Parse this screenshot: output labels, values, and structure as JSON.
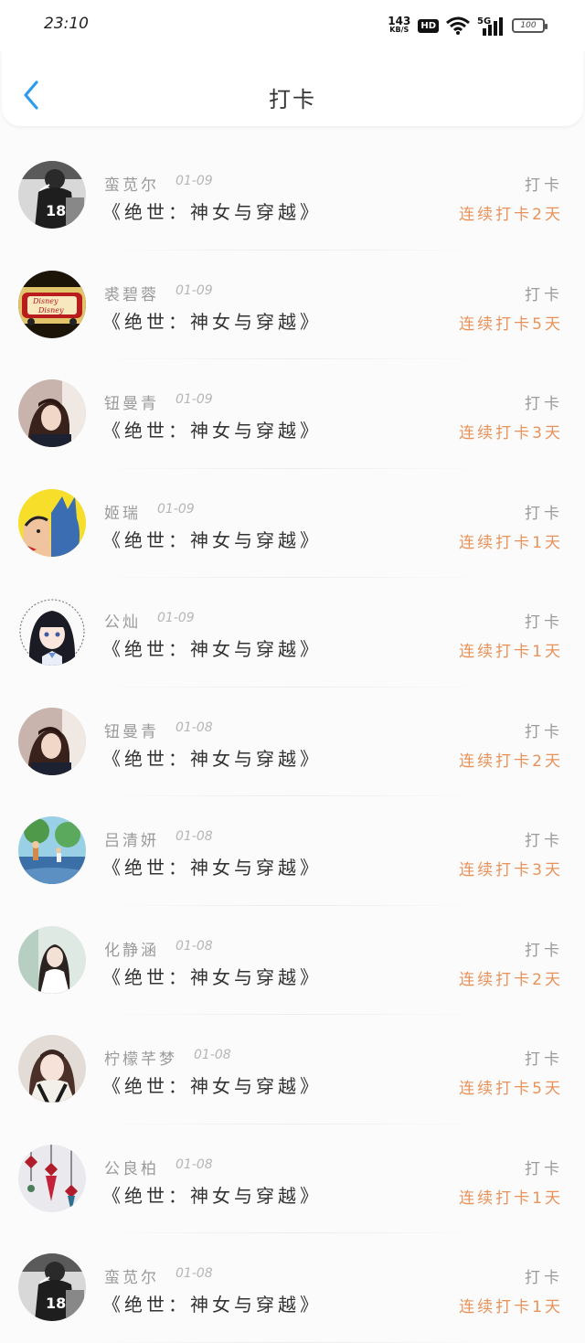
{
  "status_bar": {
    "time": "23:10",
    "net_speed": "143",
    "net_unit": "KB/S",
    "hd": "HD",
    "signal": "5G",
    "battery": "100"
  },
  "header": {
    "title": "打卡"
  },
  "records": [
    {
      "name": "蛮苋尔",
      "date": "01-09",
      "book": "《绝世：神女与穿越》",
      "tag": "打卡",
      "streak": "连续打卡2天",
      "avatar": "bw-boy"
    },
    {
      "name": "裘碧蓉",
      "date": "01-09",
      "book": "《绝世：神女与穿越》",
      "tag": "打卡",
      "streak": "连续打卡5天",
      "avatar": "disney"
    },
    {
      "name": "钮曼青",
      "date": "01-09",
      "book": "《绝世：神女与穿越》",
      "tag": "打卡",
      "streak": "连续打卡3天",
      "avatar": "girl-dark"
    },
    {
      "name": "姬瑞",
      "date": "01-09",
      "book": "《绝世：神女与穿越》",
      "tag": "打卡",
      "streak": "连续打卡1天",
      "avatar": "comic"
    },
    {
      "name": "公灿",
      "date": "01-09",
      "book": "《绝世：神女与穿越》",
      "tag": "打卡",
      "streak": "连续打卡1天",
      "avatar": "anime"
    },
    {
      "name": "钮曼青",
      "date": "01-08",
      "book": "《绝世：神女与穿越》",
      "tag": "打卡",
      "streak": "连续打卡2天",
      "avatar": "girl-dark"
    },
    {
      "name": "吕清妍",
      "date": "01-08",
      "book": "《绝世：神女与穿越》",
      "tag": "打卡",
      "streak": "连续打卡3天",
      "avatar": "scene"
    },
    {
      "name": "化静涵",
      "date": "01-08",
      "book": "《绝世：神女与穿越》",
      "tag": "打卡",
      "streak": "连续打卡2天",
      "avatar": "girl-light"
    },
    {
      "name": "柠檬芊梦",
      "date": "01-08",
      "book": "《绝世：神女与穿越》",
      "tag": "打卡",
      "streak": "连续打卡5天",
      "avatar": "girl-hoodie"
    },
    {
      "name": "公良柏",
      "date": "01-08",
      "book": "《绝世：神女与穿越》",
      "tag": "打卡",
      "streak": "连续打卡1天",
      "avatar": "knots"
    },
    {
      "name": "蛮苋尔",
      "date": "01-08",
      "book": "《绝世：神女与穿越》",
      "tag": "打卡",
      "streak": "连续打卡1天",
      "avatar": "bw-boy"
    }
  ],
  "colors": {
    "accent": "#e8925a",
    "back": "#2f9bef"
  }
}
